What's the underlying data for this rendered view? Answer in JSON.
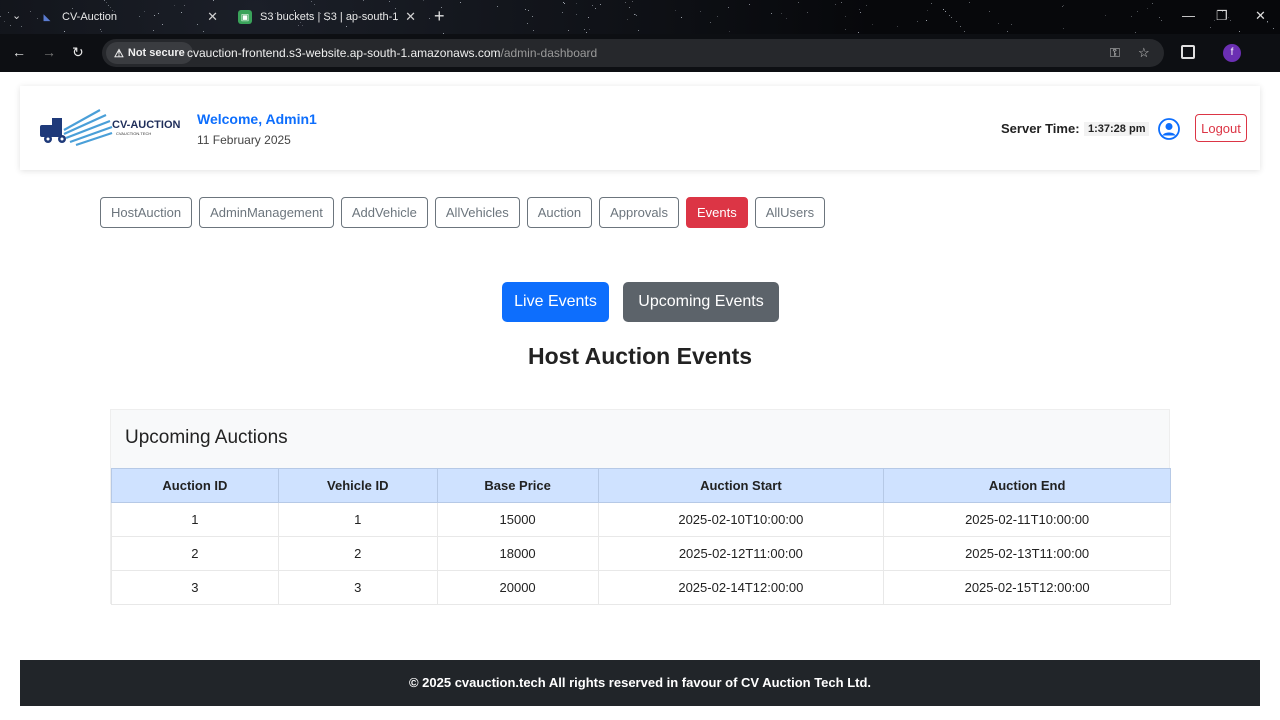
{
  "browser": {
    "tabs": [
      {
        "title": "CV-Auction",
        "active": true
      },
      {
        "title": "S3 buckets | S3 | ap-south-1",
        "active": false
      }
    ],
    "not_secure": "Not secure",
    "url_host": "cvauction-frontend.s3-website.ap-south-1.amazonaws.com",
    "url_path": "/admin-dashboard",
    "profile_initial": "f"
  },
  "header": {
    "logo_text": "CV-AUCTION",
    "logo_sub": "CVAUCTION.TECH",
    "welcome": "Welcome, Admin1",
    "date": "11 February 2025",
    "server_time_label": "Server Time:",
    "server_time": "1:37:28 pm",
    "logout": "Logout"
  },
  "nav": {
    "items": [
      "HostAuction",
      "AdminManagement",
      "AddVehicle",
      "AllVehicles",
      "Auction",
      "Approvals",
      "Events",
      "AllUsers"
    ],
    "active": "Events"
  },
  "events": {
    "live_label": "Live Events",
    "upcoming_label": "Upcoming Events",
    "title": "Host Auction Events"
  },
  "upcoming": {
    "heading": "Upcoming Auctions",
    "columns": [
      "Auction ID",
      "Vehicle ID",
      "Base Price",
      "Auction Start",
      "Auction End"
    ],
    "rows": [
      [
        "1",
        "1",
        "15000",
        "2025-02-10T10:00:00",
        "2025-02-11T10:00:00"
      ],
      [
        "2",
        "2",
        "18000",
        "2025-02-12T11:00:00",
        "2025-02-13T11:00:00"
      ],
      [
        "3",
        "3",
        "20000",
        "2025-02-14T12:00:00",
        "2025-02-15T12:00:00"
      ]
    ]
  },
  "footer": {
    "text": "© 2025 cvauction.tech All rights reserved in favour of CV Auction Tech Ltd."
  },
  "colors": {
    "primary": "#0d6efd",
    "danger": "#dc3545",
    "secondary": "#5c636a",
    "table_header": "#cfe2ff",
    "footer_bg": "#212529"
  }
}
